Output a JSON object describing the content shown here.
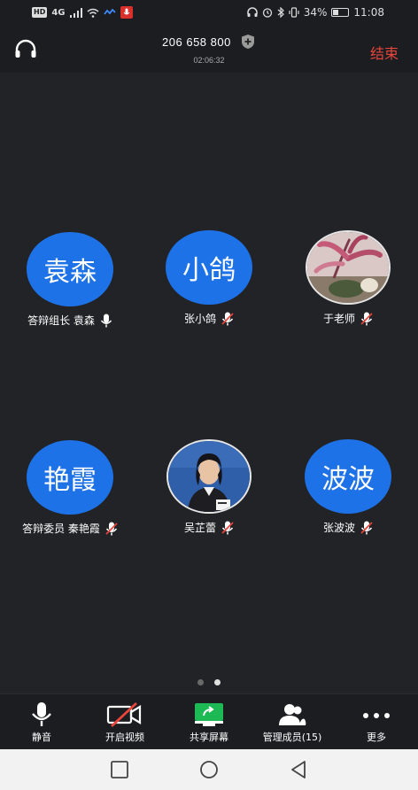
{
  "status_bar": {
    "network": "4G",
    "battery_pct": "34%",
    "time": "11:08",
    "hd_badge": "HD"
  },
  "meeting": {
    "id": "206 658 800",
    "timer": "02:06:32",
    "end_label": "结束"
  },
  "participants": [
    {
      "avatar_text": "袁森",
      "name": "答辩组长 袁森",
      "mic": "on",
      "avatar_type": "text"
    },
    {
      "avatar_text": "小鸽",
      "name": "张小鸽",
      "mic": "muted",
      "avatar_type": "text"
    },
    {
      "avatar_text": "",
      "name": "于老师",
      "mic": "muted",
      "avatar_type": "photo-flower"
    },
    {
      "avatar_text": "艳霞",
      "name": "答辩委员 秦艳霞",
      "mic": "muted",
      "avatar_type": "text"
    },
    {
      "avatar_text": "",
      "name": "吴芷蕾",
      "mic": "muted",
      "avatar_type": "photo-person"
    },
    {
      "avatar_text": "波波",
      "name": "张波波",
      "mic": "muted",
      "avatar_type": "text"
    }
  ],
  "page_indicator": {
    "current": 2,
    "total": 2
  },
  "toolbar": {
    "mute_label": "静音",
    "video_label": "开启视频",
    "share_label": "共享屏幕",
    "members_label": "管理成员(15)",
    "more_label": "更多"
  },
  "colors": {
    "avatar_blue": "#1e72e8",
    "end_red": "#e8453c",
    "share_green": "#1db954",
    "mute_red": "#e8453c"
  }
}
